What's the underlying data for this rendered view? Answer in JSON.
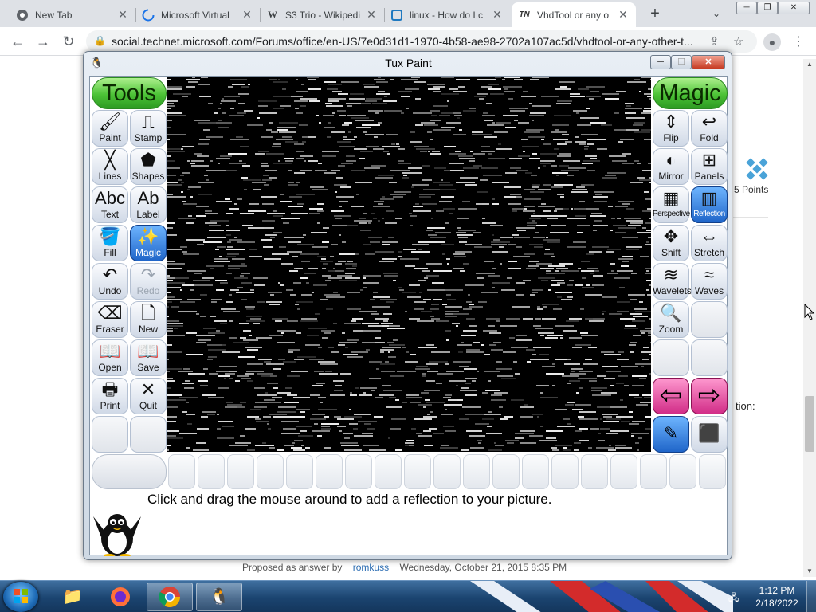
{
  "browser": {
    "tabs": [
      {
        "title": "New Tab",
        "icon": "chrome-icon"
      },
      {
        "title": "Microsoft Virtual",
        "icon": "loading-icon"
      },
      {
        "title": "S3 Trio - Wikipedi",
        "icon": "wikipedia-icon",
        "favicon_text": "W"
      },
      {
        "title": "linux - How do I c",
        "icon": "superuser-icon"
      },
      {
        "title": "VhdTool or any o",
        "icon": "technet-icon",
        "favicon_text": "TN"
      }
    ],
    "url": "social.technet.microsoft.com/Forums/office/en-US/7e0d31d1-1970-4b58-ae98-2702a107ac5d/vhdtool-or-any-other-t..."
  },
  "tuxpaint": {
    "window_title": "Tux Paint",
    "tools_header": "Tools",
    "magic_header": "Magic",
    "tools": [
      {
        "label": "Paint",
        "glyph": "🖌"
      },
      {
        "label": "Stamp",
        "glyph": "⎍"
      },
      {
        "label": "Lines",
        "glyph": "╳"
      },
      {
        "label": "Shapes",
        "glyph": "⬟"
      },
      {
        "label": "Text",
        "glyph": "Abc"
      },
      {
        "label": "Label",
        "glyph": "Ab"
      },
      {
        "label": "Fill",
        "glyph": "🪣"
      },
      {
        "label": "Magic",
        "glyph": "✨"
      },
      {
        "label": "Undo",
        "glyph": "↶"
      },
      {
        "label": "Redo",
        "glyph": "↷"
      },
      {
        "label": "Eraser",
        "glyph": "⌫"
      },
      {
        "label": "New",
        "glyph": "🗋"
      },
      {
        "label": "Open",
        "glyph": "📖"
      },
      {
        "label": "Save",
        "glyph": "📖"
      },
      {
        "label": "Print",
        "glyph": "🖶"
      },
      {
        "label": "Quit",
        "glyph": "✕"
      }
    ],
    "magic": [
      {
        "label": "Flip",
        "glyph": "⇕"
      },
      {
        "label": "Fold",
        "glyph": "↩"
      },
      {
        "label": "Mirror",
        "glyph": "◐"
      },
      {
        "label": "Panels",
        "glyph": "⊞"
      },
      {
        "label": "Perspective",
        "glyph": "▦"
      },
      {
        "label": "Reflection",
        "glyph": "▥"
      },
      {
        "label": "Shift",
        "glyph": "✥"
      },
      {
        "label": "Stretch",
        "glyph": "⇔"
      },
      {
        "label": "Wavelets",
        "glyph": "≋"
      },
      {
        "label": "Waves",
        "glyph": "≈"
      },
      {
        "label": "Zoom",
        "glyph": "🔍"
      }
    ],
    "selected_tool": "Magic",
    "selected_magic": "Reflection",
    "instruction": "Click and drag the mouse around to add a reflection to your picture."
  },
  "page_bg": {
    "proposed_by_label": "Proposed as answer by",
    "proposed_by_name": "romkuss",
    "proposed_date": "Wednesday, October 21, 2015 8:35 PM",
    "points": "5 Points",
    "partial_text": "tion:"
  },
  "taskbar": {
    "time": "1:12 PM",
    "date": "2/18/2022"
  },
  "colors": {
    "tools_header": "#4cc236",
    "selected": "#1e64c8",
    "nav_arrow": "#d12a86"
  }
}
